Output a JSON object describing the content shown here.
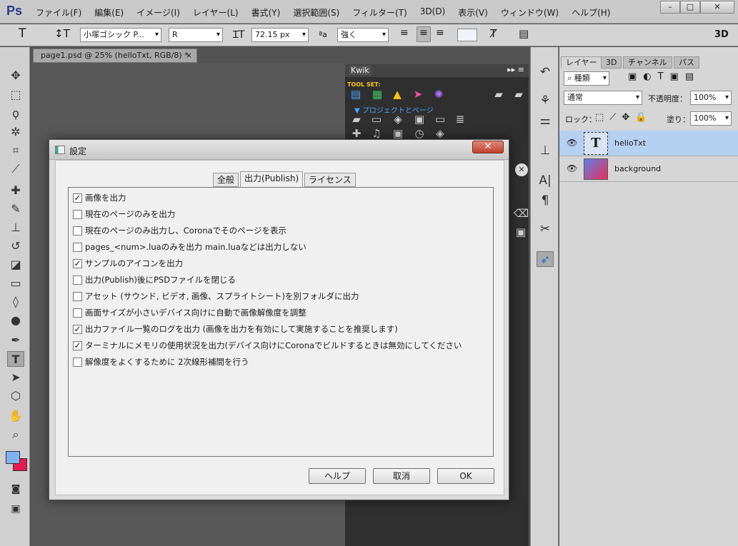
{
  "app": {
    "logo": "Ps"
  },
  "menu": [
    "ファイル(F)",
    "編集(E)",
    "イメージ(I)",
    "レイヤー(L)",
    "書式(Y)",
    "選択範囲(S)",
    "フィルター(T)",
    "3D(D)",
    "表示(V)",
    "ウィンドウ(W)",
    "ヘルプ(H)"
  ],
  "window_controls": {
    "minimize": "–",
    "maximize": "□",
    "close": "✕"
  },
  "options": {
    "font_family": "小塚ゴシック P...",
    "font_style": "R",
    "font_size": "72.15 px",
    "aa_label": "ªa",
    "antialias": "強く",
    "mode_3d": "3D"
  },
  "document": {
    "tab_title": "page1.psd @ 25% (helloTxt, RGB/8) *",
    "tab_close": "×"
  },
  "kwik": {
    "title": "Kwik",
    "toolset_label": "TOOL SET:",
    "section_label": "プロジェクトとページ"
  },
  "layers_panel": {
    "tabs": [
      "レイヤー",
      "3D",
      "チャンネル",
      "パス"
    ],
    "filter": "種類",
    "blend_mode": "通常",
    "opacity_label": "不透明度：",
    "opacity": "100%",
    "lock_label": "ロック：",
    "fill_label": "塗り：",
    "fill": "100%",
    "layers": [
      {
        "name": "helloTxt",
        "selected": true,
        "thumb": "T"
      },
      {
        "name": "background",
        "selected": false,
        "thumb": ""
      }
    ]
  },
  "dialog": {
    "title": "設定",
    "close": "✕",
    "tabs": [
      "全般",
      "出力(Publish)",
      "ライセンス"
    ],
    "active_tab": "出力(Publish)",
    "options": [
      {
        "label": "画像を出力",
        "checked": true
      },
      {
        "label": "現在のページのみを出力",
        "checked": false
      },
      {
        "label": "現在のページのみ出力し、Coronaでそのページを表示",
        "checked": false
      },
      {
        "label": "pages_<num>.luaのみを出力 main.luaなどは出力しない",
        "checked": false
      },
      {
        "label": "サンプルのアイコンを出力",
        "checked": true
      },
      {
        "label": "出力(Publish)後にPSDファイルを閉じる",
        "checked": false
      },
      {
        "label": "アセット (サウンド, ビデオ, 画像、スプライトシート)を別フォルダに出力",
        "checked": false
      },
      {
        "label": "画面サイズが小さいデバイス向けに自動で画像解像度を調整",
        "checked": false
      },
      {
        "label": "出力ファイル一覧のログを出力 (画像を出力を有効にして実施することを推奨します)",
        "checked": true
      },
      {
        "label": "ターミナルにメモリの使用状況を出力(デバイス向けにCoronaでビルドするときは無効にしてください",
        "checked": true
      },
      {
        "label": "解像度をよくするために 2次線形補間を行う",
        "checked": false
      }
    ],
    "buttons": {
      "help": "ヘルプ",
      "cancel": "取消",
      "ok": "OK"
    }
  }
}
